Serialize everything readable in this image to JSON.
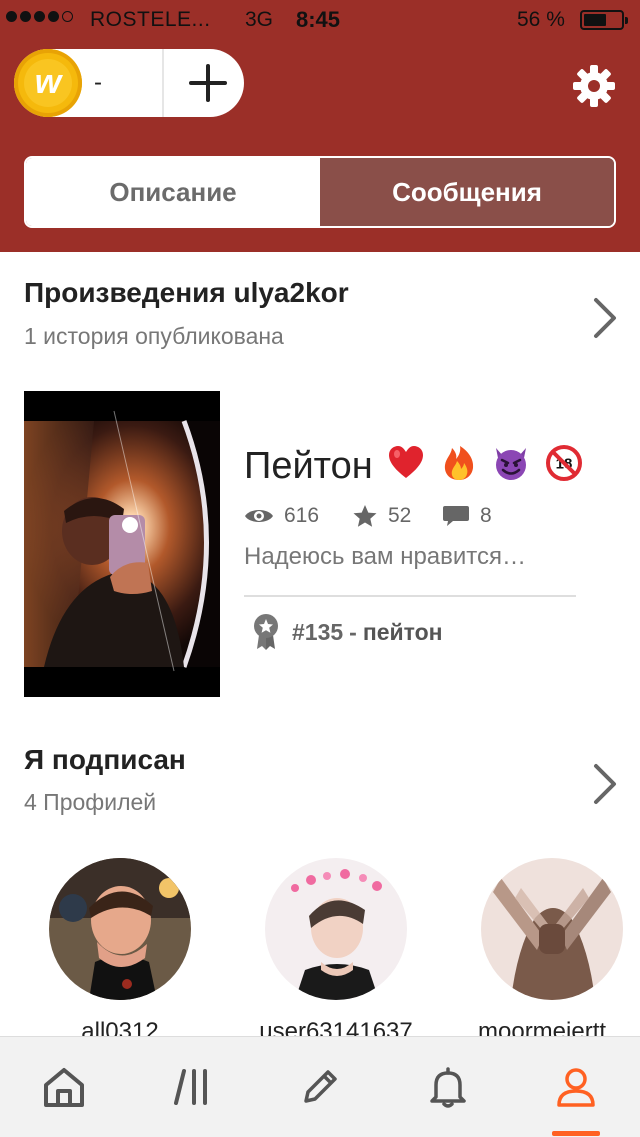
{
  "status_bar": {
    "carrier": "ROSTELE...",
    "network": "3G",
    "time": "8:45",
    "battery": "56 %"
  },
  "header": {
    "coins": {
      "count": "-",
      "coin_letter": "w"
    },
    "tabs": [
      {
        "label": "Описание",
        "active": false
      },
      {
        "label": "Сообщения",
        "active": true
      }
    ]
  },
  "works": {
    "title_prefix": "Произведения",
    "username": "ulya2kor",
    "subtitle": "1 история опубликована",
    "story": {
      "title": "Пейтон",
      "emojis": [
        "heart",
        "fire",
        "smiling-devil",
        "no-under-18"
      ],
      "views": "616",
      "votes": "52",
      "comments": "8",
      "description": "Надеюсь вам нравится…",
      "rank": "#135",
      "rank_separator": "-",
      "rank_tag": "пейтон"
    }
  },
  "following": {
    "title": "Я подписан",
    "subtitle": "4 Профилей",
    "profiles": [
      {
        "name": "all0312"
      },
      {
        "name": "user63141637"
      },
      {
        "name": "moormeiertt"
      }
    ]
  },
  "tab_bar": {
    "items": [
      {
        "icon": "home-icon"
      },
      {
        "icon": "library-icon"
      },
      {
        "icon": "pencil-icon"
      },
      {
        "icon": "bell-icon"
      },
      {
        "icon": "profile-icon",
        "active": true
      }
    ],
    "active_color": "#ff6122"
  },
  "colors": {
    "header_bg": "#9b2f28",
    "active_tab_bg": "#8a4f49",
    "coin": "#f5b90c"
  }
}
